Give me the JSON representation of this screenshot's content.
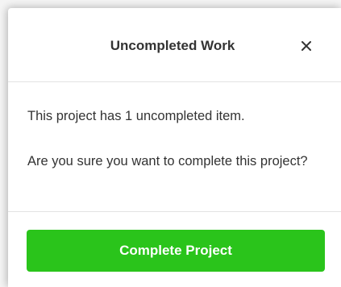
{
  "dialog": {
    "title": "Uncompleted Work",
    "close_icon": "close-icon",
    "message_line1": "This project has 1 uncompleted item.",
    "message_line2": "Are you sure you want to complete this project?",
    "confirm_label": "Complete Project"
  },
  "colors": {
    "accent_green": "#2ac41b",
    "text": "#333333",
    "divider": "#e3e3e3"
  }
}
